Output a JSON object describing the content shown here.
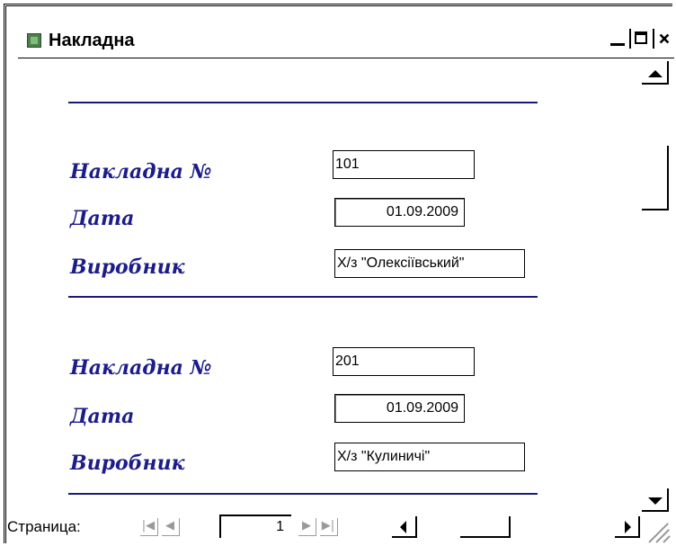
{
  "window": {
    "title": "Накладна",
    "icon": "access-form-icon"
  },
  "records": [
    {
      "invoice_label": "Накладна №",
      "invoice_value": "101",
      "date_label": "Дата",
      "date_value": "01.09.2009",
      "producer_label": "Виробник",
      "producer_value": "Х/з \"Олексіївський\""
    },
    {
      "invoice_label": "Накладна №",
      "invoice_value": "201",
      "date_label": "Дата",
      "date_value": "01.09.2009",
      "producer_label": "Виробник",
      "producer_value": "Х/з \"Кулиничі\""
    }
  ],
  "navigation": {
    "label": "Страница:",
    "current_page": "1"
  },
  "colors": {
    "label_text": "#1c1c8a",
    "separator": "#1a1a7a",
    "disabled_nav": "#9a9a9a"
  }
}
